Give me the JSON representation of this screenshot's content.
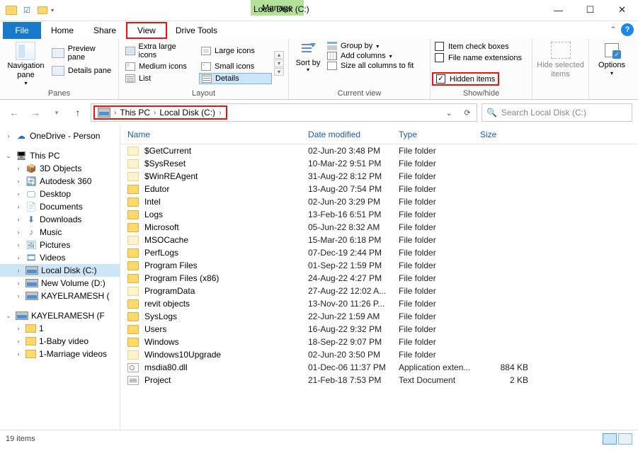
{
  "window": {
    "title": "Local Disk (C:)",
    "manage_tab": "Manage"
  },
  "tabs": {
    "file": "File",
    "home": "Home",
    "share": "Share",
    "view": "View",
    "drive_tools": "Drive Tools"
  },
  "ribbon": {
    "panes": {
      "nav": "Navigation pane",
      "preview": "Preview pane",
      "details": "Details pane",
      "group": "Panes"
    },
    "layout": {
      "xl": "Extra large icons",
      "lg": "Large icons",
      "md": "Medium icons",
      "sm": "Small icons",
      "list": "List",
      "details": "Details",
      "group": "Layout"
    },
    "currentview": {
      "sortby": "Sort by",
      "groupby": "Group by",
      "addcols": "Add columns",
      "sizeall": "Size all columns to fit",
      "group": "Current view"
    },
    "showhide": {
      "itemcb": "Item check boxes",
      "fileext": "File name extensions",
      "hidden": "Hidden items",
      "group": "Show/hide"
    },
    "hidesel": "Hide selected items",
    "options": "Options"
  },
  "address": {
    "thispc": "This PC",
    "location": "Local Disk (C:)",
    "search_placeholder": "Search Local Disk (C:)"
  },
  "tree": {
    "onedrive": "OneDrive - Person",
    "thispc": "This PC",
    "items": [
      "3D Objects",
      "Autodesk 360",
      "Desktop",
      "Documents",
      "Downloads",
      "Music",
      "Pictures",
      "Videos",
      "Local Disk (C:)",
      "New Volume (D:)",
      "KAYELRAMESH ("
    ],
    "drive_f": "KAYELRAMESH (F",
    "sub": [
      "1",
      "1-Baby video",
      "1-Marriage videos"
    ]
  },
  "columns": {
    "name": "Name",
    "date": "Date modified",
    "type": "Type",
    "size": "Size"
  },
  "files": [
    {
      "name": "$GetCurrent",
      "date": "02-Jun-20 3:48 PM",
      "type": "File folder",
      "size": "",
      "ico": "folder-light"
    },
    {
      "name": "$SysReset",
      "date": "10-Mar-22 9:51 PM",
      "type": "File folder",
      "size": "",
      "ico": "folder-light"
    },
    {
      "name": "$WinREAgent",
      "date": "31-Aug-22 8:12 PM",
      "type": "File folder",
      "size": "",
      "ico": "folder-light"
    },
    {
      "name": "Edutor",
      "date": "13-Aug-20 7:54 PM",
      "type": "File folder",
      "size": "",
      "ico": "folder"
    },
    {
      "name": "Intel",
      "date": "02-Jun-20 3:29 PM",
      "type": "File folder",
      "size": "",
      "ico": "folder"
    },
    {
      "name": "Logs",
      "date": "13-Feb-16 6:51 PM",
      "type": "File folder",
      "size": "",
      "ico": "folder"
    },
    {
      "name": "Microsoft",
      "date": "05-Jun-22 8:32 AM",
      "type": "File folder",
      "size": "",
      "ico": "folder"
    },
    {
      "name": "MSOCache",
      "date": "15-Mar-20 6:18 PM",
      "type": "File folder",
      "size": "",
      "ico": "folder-light"
    },
    {
      "name": "PerfLogs",
      "date": "07-Dec-19 2:44 PM",
      "type": "File folder",
      "size": "",
      "ico": "folder"
    },
    {
      "name": "Program Files",
      "date": "01-Sep-22 1:59 PM",
      "type": "File folder",
      "size": "",
      "ico": "folder"
    },
    {
      "name": "Program Files (x86)",
      "date": "24-Aug-22 4:27 PM",
      "type": "File folder",
      "size": "",
      "ico": "folder"
    },
    {
      "name": "ProgramData",
      "date": "27-Aug-22 12:02 A...",
      "type": "File folder",
      "size": "",
      "ico": "folder-light"
    },
    {
      "name": "revit objects",
      "date": "13-Nov-20 11:26 P...",
      "type": "File folder",
      "size": "",
      "ico": "folder"
    },
    {
      "name": "SysLogs",
      "date": "22-Jun-22 1:59 AM",
      "type": "File folder",
      "size": "",
      "ico": "folder"
    },
    {
      "name": "Users",
      "date": "16-Aug-22 9:32 PM",
      "type": "File folder",
      "size": "",
      "ico": "folder"
    },
    {
      "name": "Windows",
      "date": "18-Sep-22 9:07 PM",
      "type": "File folder",
      "size": "",
      "ico": "folder"
    },
    {
      "name": "Windows10Upgrade",
      "date": "02-Jun-20 3:50 PM",
      "type": "File folder",
      "size": "",
      "ico": "folder-light"
    },
    {
      "name": "msdia80.dll",
      "date": "01-Dec-06 11:37 PM",
      "type": "Application exten...",
      "size": "884 KB",
      "ico": "dll"
    },
    {
      "name": "Project",
      "date": "21-Feb-18 7:53 PM",
      "type": "Text Document",
      "size": "2 KB",
      "ico": "txt"
    }
  ],
  "status": {
    "count": "19 items"
  }
}
